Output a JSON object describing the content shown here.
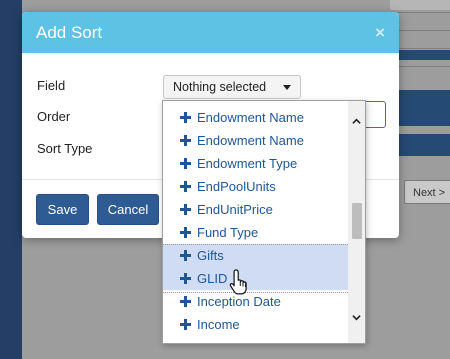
{
  "modal": {
    "title": "Add Sort",
    "close_glyph": "×"
  },
  "form": {
    "field_label": "Field",
    "order_label": "Order",
    "sort_type_label": "Sort Type",
    "field_select_value": "Nothing selected"
  },
  "buttons": {
    "save": "Save",
    "cancel": "Cancel"
  },
  "background": {
    "next_button": "Next >"
  },
  "dropdown": {
    "items": [
      {
        "label": "Endowment Name",
        "highlighted": false
      },
      {
        "label": "Endowment Name",
        "highlighted": false
      },
      {
        "label": "Endowment Type",
        "highlighted": false
      },
      {
        "label": "EndPoolUnits",
        "highlighted": false
      },
      {
        "label": "EndUnitPrice",
        "highlighted": false
      },
      {
        "label": "Fund Type",
        "highlighted": false
      },
      {
        "label": "Gifts",
        "highlighted": true
      },
      {
        "label": "GLID",
        "highlighted": true
      },
      {
        "label": "Inception Date",
        "highlighted": false
      },
      {
        "label": "Income",
        "highlighted": false
      }
    ]
  },
  "colors": {
    "header": "#5ec2e4",
    "primary_button": "#2f5b95",
    "item_text": "#1f5795",
    "item_highlight": "#cfdcf4"
  },
  "icons": {
    "item": "plus-icon",
    "close": "close-icon",
    "caret": "caret-down-icon",
    "scroll_up": "chevron-up-icon",
    "scroll_down": "chevron-down-icon",
    "cursor": "hand-pointer-icon"
  }
}
